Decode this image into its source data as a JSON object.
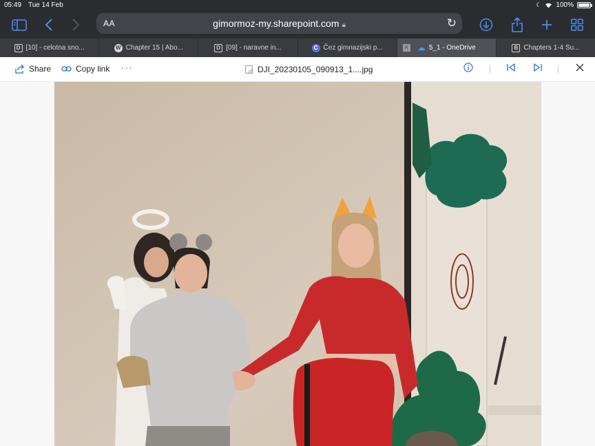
{
  "status": {
    "time": "05:49",
    "date": "Tue 14 Feb",
    "battery": "100%",
    "battery_level": 1.0
  },
  "browser": {
    "aa_label": "AA",
    "url": "gimormoz-my.sharepoint.com",
    "tabs": [
      {
        "label": "[10] - celotna sno...",
        "icon": "d-icon"
      },
      {
        "label": "Chapter 15 | Abo...",
        "icon": "wordpress-icon"
      },
      {
        "label": "[09] - naravne in...",
        "icon": "d-icon"
      },
      {
        "label": "Čez gimnazijski p...",
        "icon": "copilot-icon"
      },
      {
        "label": "5_1 - OneDrive",
        "icon": "onedrive-icon",
        "active": true
      },
      {
        "label": "Chapters 1-4 Su...",
        "icon": "b-icon"
      }
    ]
  },
  "viewer": {
    "share_label": "Share",
    "copy_link_label": "Copy link",
    "more_label": "···",
    "file_name": "DJI_20230105_090913_1....jpg"
  },
  "colors": {
    "chrome": "#2b2c2f",
    "accent": "#4a8df6",
    "viewer_accent": "#2a6fd1"
  }
}
